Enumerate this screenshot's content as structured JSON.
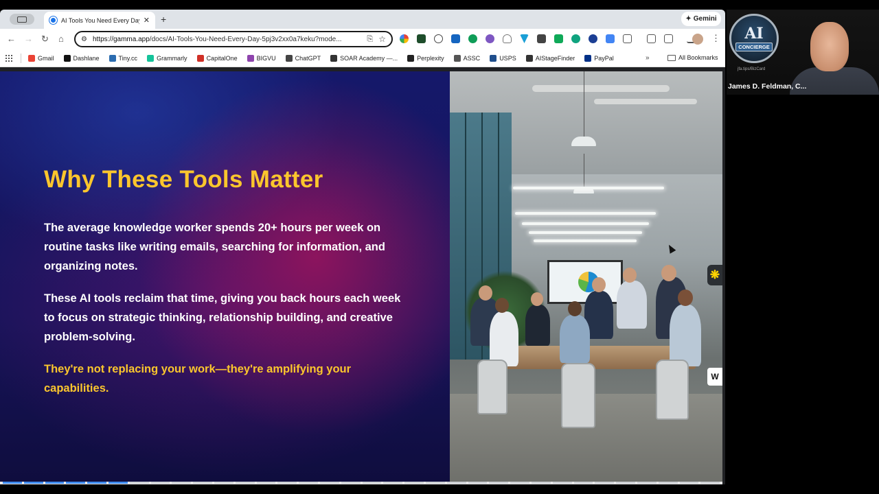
{
  "browser": {
    "tab_title": "AI Tools You Need Every Day",
    "tab_close": "✕",
    "new_tab": "+",
    "gemini_label": "Gemini",
    "url_host": "https://gamma.app",
    "url_path": "/docs/AI-Tools-You-Need-Every-Day-5pj3v2xx0a7keku?mode...",
    "bookmarks": [
      {
        "label": "Gmail",
        "color": "#ea4335"
      },
      {
        "label": "Dashlane",
        "color": "#111111"
      },
      {
        "label": "Tiny.cc",
        "color": "#2b6cb0"
      },
      {
        "label": "Grammarly",
        "color": "#15c39a"
      },
      {
        "label": "CapitalOne",
        "color": "#d03027"
      },
      {
        "label": "BIGVU",
        "color": "#8e44ad"
      },
      {
        "label": "ChatGPT",
        "color": "#444444"
      },
      {
        "label": "SOAR Academy —...",
        "color": "#333333"
      },
      {
        "label": "Perplexity",
        "color": "#222222"
      },
      {
        "label": "ASSC",
        "color": "#555555"
      },
      {
        "label": "USPS",
        "color": "#1f4e8c"
      },
      {
        "label": "AIStageFinder",
        "color": "#333333"
      },
      {
        "label": "PayPal",
        "color": "#003087"
      }
    ],
    "bookmarks_more": "»",
    "all_bookmarks": "All Bookmarks"
  },
  "slide": {
    "headline": "Why These Tools Matter",
    "paragraph_1": "The average knowledge worker spends 20+ hours per week on routine tasks like writing emails, searching for information, and organizing notes.",
    "paragraph_2": "These AI tools reclaim that time, giving you back hours each week to focus on strategic thinking, relationship building, and creative problem-solving.",
    "paragraph_3": "They're not replacing your work—they're amplifying your capabilities.",
    "accent_color": "#fbc62d"
  },
  "floating": {
    "star_glyph": "❋",
    "w_glyph": "W"
  },
  "video": {
    "logo_text": "AI",
    "logo_badge": "CONCIERGE",
    "logo_sub": "jfa.tips/BizCard",
    "participant_name": "James D. Feldman, C..."
  }
}
